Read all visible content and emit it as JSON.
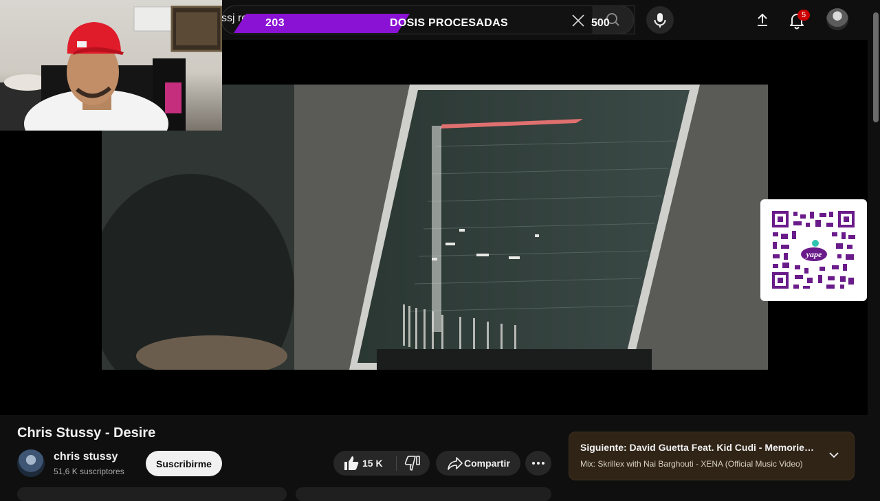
{
  "overlay": {
    "count": "203",
    "label": "DOSIS PROCESADAS",
    "goal": "500"
  },
  "search": {
    "value": "ssj ro"
  },
  "notifications": {
    "badge": "5"
  },
  "video": {
    "title": "Chris Stussy - Desire"
  },
  "channel": {
    "name": "chris stussy",
    "subscribers": "51,6 K suscriptores"
  },
  "actions": {
    "subscribe_label": "Suscribirme",
    "like_count": "15 K",
    "share_label": "Compartir"
  },
  "up_next": {
    "title": "Siguiente: David Guetta Feat. Kid Cudi - Memories (...",
    "subtitle": "Mix: Skrillex with Nai Barghouti - XENA (Official Music Video)"
  },
  "qr": {
    "logo_text": "yape"
  },
  "colors": {
    "overlay_purple": "#8a12d4",
    "background": "#0f0f0f",
    "subscribe_bg": "#f1f1f1",
    "up_next_bg": "#2f2416",
    "badge_red": "#cc0000"
  }
}
